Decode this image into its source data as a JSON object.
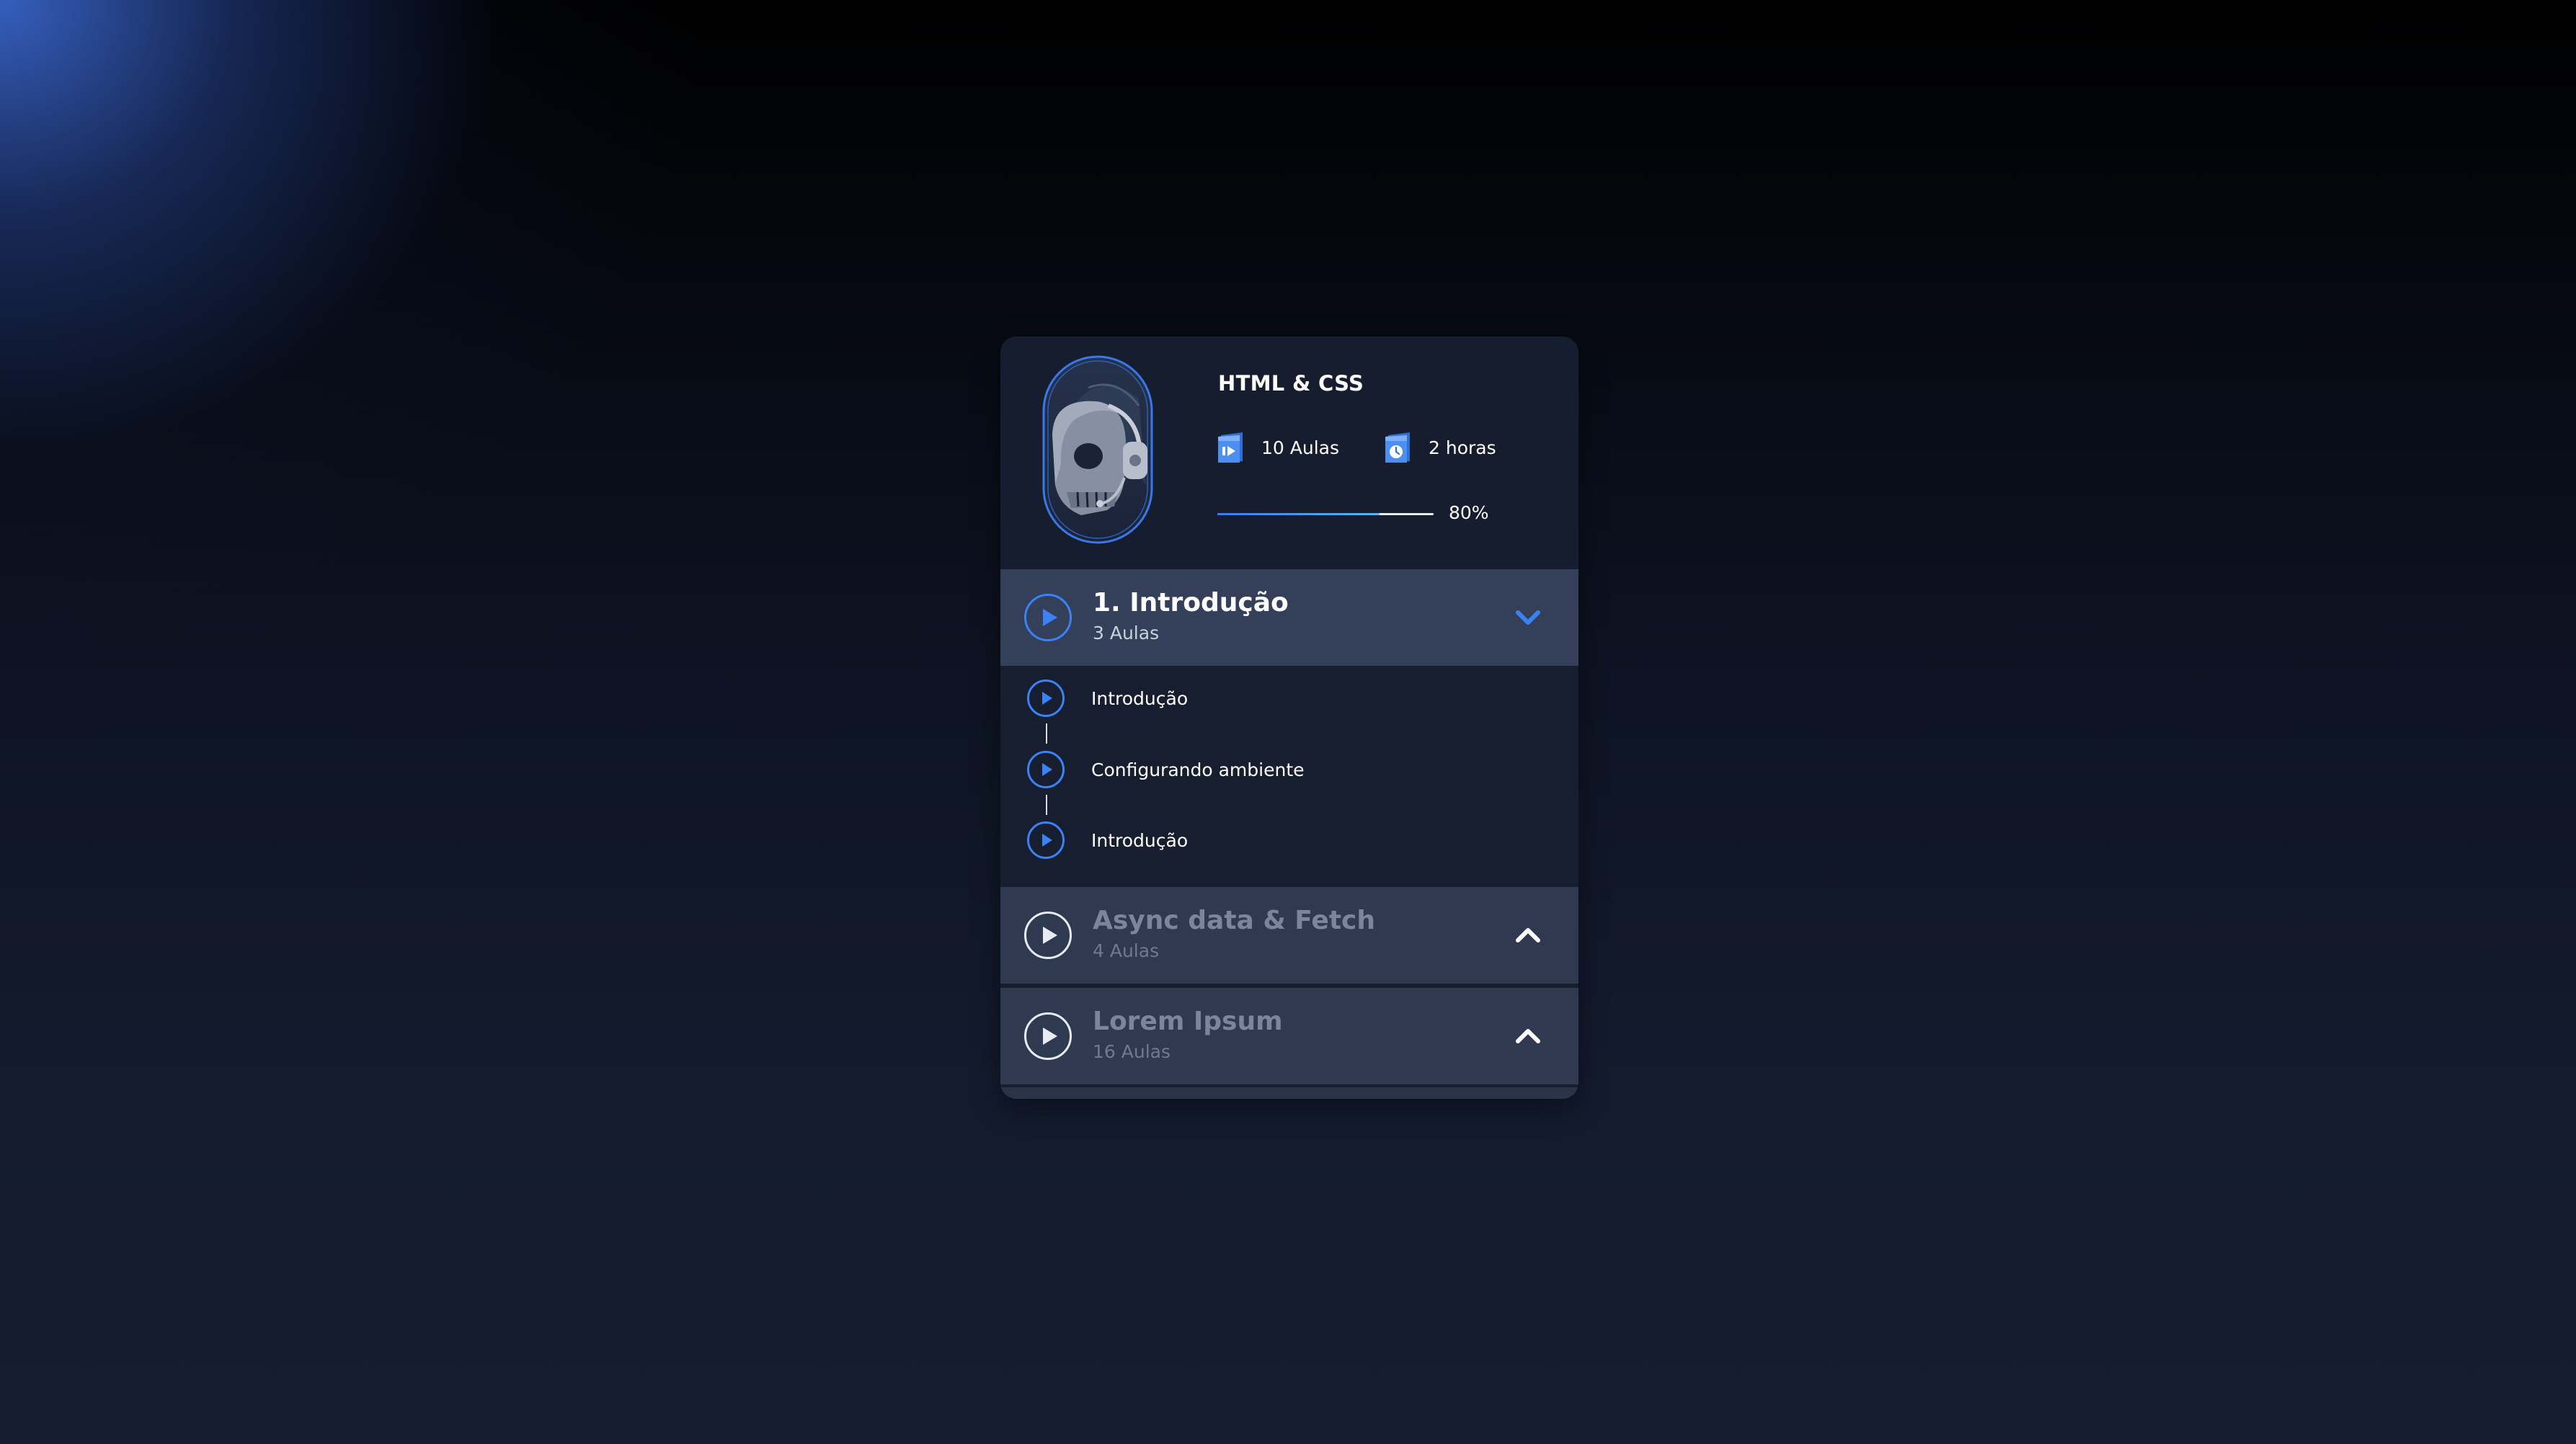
{
  "course": {
    "title": "HTML & CSS",
    "lessons_label": "10 Aulas",
    "hours_label": "2 horas",
    "progress_text": "80%",
    "progress_fraction": 0.75,
    "lessons_icon": "video-lessons-icon",
    "hours_icon": "clock-icon",
    "cover_icon": "robot-skull-cover"
  },
  "modules": [
    {
      "title": "1. Introdução",
      "count": "3 Aulas",
      "expanded": true,
      "lessons": [
        {
          "title": "Introdução"
        },
        {
          "title": "Configurando ambiente"
        },
        {
          "title": "Introdução"
        }
      ]
    },
    {
      "title": "Async data & Fetch",
      "count": "4 Aulas",
      "expanded": false
    },
    {
      "title": "Lorem Ipsum",
      "count": "16 Aulas",
      "expanded": false
    }
  ],
  "colors": {
    "accent": "#3b82f6",
    "card_bg": "#171e30",
    "module_active_bg": "#344059",
    "module_bg": "#2f3a51",
    "muted_text": "#7c869b"
  }
}
